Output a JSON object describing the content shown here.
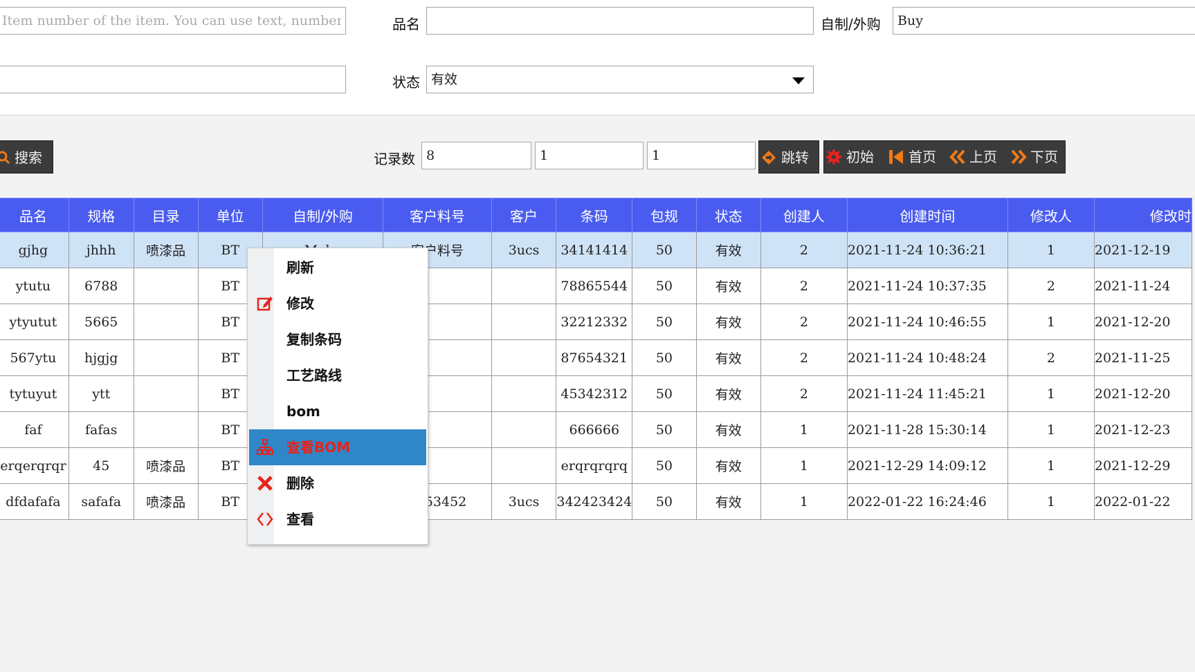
{
  "form": {
    "item_number_placeholder": "Item number of the item. You can use text, numbers",
    "name_label": "品名",
    "name_value": "",
    "make_buy_label": "自制/外购",
    "make_buy_value": "Buy",
    "second_input_value": "",
    "status_label": "状态",
    "status_value": "有效"
  },
  "toolbar": {
    "search_label": "搜索",
    "record_count_label": "记录数",
    "record_count_value": "8",
    "page_size_value": "1",
    "page_number_value": "1",
    "jump_label": "跳转",
    "reset_label": "初始",
    "first_label": "首页",
    "prev_label": "上页",
    "next_label": "下页"
  },
  "table": {
    "columns": [
      "品名",
      "规格",
      "目录",
      "单位",
      "自制/外购",
      "客户料号",
      "客户",
      "条码",
      "包规",
      "状态",
      "创建人",
      "创建时间",
      "修改人",
      "修改时"
    ],
    "rows": [
      [
        "gjhg",
        "jhhh",
        "喷漆品",
        "BT",
        "Make",
        "客户料号",
        "3ucs",
        "34141414",
        "50",
        "有效",
        "2",
        "2021-11-24 10:36:21",
        "1",
        "2021-12-19"
      ],
      [
        "ytutu",
        "6788",
        "",
        "BT",
        "",
        "",
        "",
        "78865544",
        "50",
        "有效",
        "2",
        "2021-11-24 10:37:35",
        "2",
        "2021-11-24"
      ],
      [
        "ytyutut",
        "5665",
        "",
        "BT",
        "",
        "",
        "",
        "32212332",
        "50",
        "有效",
        "2",
        "2021-11-24 10:46:55",
        "1",
        "2021-12-20"
      ],
      [
        "567ytu",
        "hjgjg",
        "",
        "BT",
        "",
        "",
        "",
        "87654321",
        "50",
        "有效",
        "2",
        "2021-11-24 10:48:24",
        "2",
        "2021-11-25"
      ],
      [
        "tytuyut",
        "ytt",
        "",
        "BT",
        "",
        "",
        "",
        "45342312",
        "50",
        "有效",
        "2",
        "2021-11-24 11:45:21",
        "1",
        "2021-12-20"
      ],
      [
        "faf",
        "fafas",
        "",
        "BT",
        "",
        "",
        "",
        "666666",
        "50",
        "有效",
        "1",
        "2021-11-28 15:30:14",
        "1",
        "2021-12-23"
      ],
      [
        "erqerqrqr",
        "45",
        "喷漆品",
        "BT",
        "",
        "",
        "",
        "erqrqrqrq",
        "50",
        "有效",
        "1",
        "2021-12-29 14:09:12",
        "1",
        "2021-12-29"
      ],
      [
        "dfdafafa",
        "safafa",
        "喷漆品",
        "BT",
        "",
        "5353452",
        "3ucs",
        "342423424",
        "50",
        "有效",
        "1",
        "2022-01-22 16:24:46",
        "1",
        "2022-01-22"
      ]
    ]
  },
  "context_menu": {
    "items": [
      {
        "label": "刷新",
        "icon": ""
      },
      {
        "label": "修改",
        "icon": "edit-icon"
      },
      {
        "label": "复制条码",
        "icon": ""
      },
      {
        "label": "工艺路线",
        "icon": ""
      },
      {
        "label": "bom",
        "icon": ""
      },
      {
        "label": "查看BOM",
        "icon": "hierarchy-icon"
      },
      {
        "label": "删除",
        "icon": "delete-x-icon"
      },
      {
        "label": "查看",
        "icon": "code-brackets-icon"
      }
    ],
    "active_index": 5
  },
  "colors": {
    "header_bg": "#4a5cf0",
    "selected_row": "#cfe3f6",
    "menu_active": "#2f87c8",
    "accent_orange": "#f07a18",
    "danger_red": "#e8231c"
  }
}
